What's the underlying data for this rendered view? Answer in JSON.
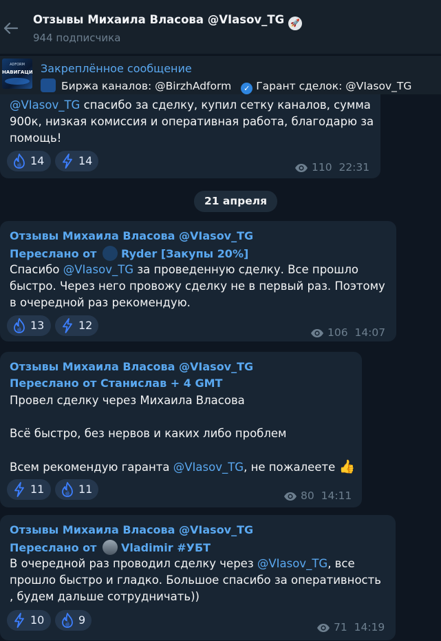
{
  "header": {
    "title": "Отзывы Михаила Власова @VIasov_TG",
    "subscribers": "944 подписчика"
  },
  "pinned": {
    "label": "Закреплённое сообщение",
    "thumb_top": "ADFORM",
    "thumb_main": "НАВИГАЦИЯ",
    "line_a": "Биржа каналов: @BirzhAdform",
    "line_b": "Гарант сделок:  @VIasov_TG"
  },
  "date_separator": "21 апреля",
  "messages": [
    {
      "text_lines": [
        "@VIasov_TG спасибо за сделку, купил сетку каналов, сумма",
        "900к, низкая комиссия и оперативная работа, благодарю за",
        "помощь!"
      ],
      "reactions": [
        {
          "icon": "flame-icon",
          "count": "14"
        },
        {
          "icon": "lightning-icon",
          "count": "14"
        }
      ],
      "views": "110",
      "time": "22:31"
    },
    {
      "author": "Отзывы Михаила Власова @VIasov_TG",
      "forwarded_prefix": "Переслано от",
      "forwarded_from": "Ryder [Закупы 20%]",
      "text_line1_a": "Спасибо ",
      "text_line1_link": "@VIasov_TG",
      "text_line1_b": " за проведенную сделку. Все прошло",
      "text_line2": "быстро. Через него провожу сделку не в первый раз. Поэтому",
      "text_line3": "в очередной раз рекомендую.",
      "reactions": [
        {
          "icon": "flame-icon",
          "count": "13"
        },
        {
          "icon": "lightning-icon",
          "count": "12"
        }
      ],
      "views": "106",
      "time": "14:07"
    },
    {
      "author": "Отзывы Михаила Власова @VIasov_TG",
      "forwarded": "Переслано от Станислав + 4 GMT",
      "text_line1": "Провел сделку через Михаила Власова",
      "text_line2": "Всё быстро, без нервов и каких либо проблем",
      "text_line3_a": "Всем рекомендую гаранта ",
      "text_line3_link": "@VIasov_TG",
      "text_line3_b": ", не пожалеете ",
      "emoji": "👍",
      "reactions": [
        {
          "icon": "lightning-icon",
          "count": "11"
        },
        {
          "icon": "flame-icon",
          "count": "11"
        }
      ],
      "views": "80",
      "time": "14:11"
    },
    {
      "author": "Отзывы Михаила Власова @VIasov_TG",
      "forwarded_prefix": "Переслано от",
      "forwarded_from": "Vladimir #УБТ",
      "text_line1_a": "В очередной раз проводил сделку через ",
      "text_line1_link": "@VIasov_TG",
      "text_line1_b": ", все",
      "text_line2": "прошло быстро и гладко. Большое спасибо за оперативность",
      "text_line3": ", будем дальше сотрудничать))",
      "reactions": [
        {
          "icon": "lightning-icon",
          "count": "10"
        },
        {
          "icon": "flame-icon",
          "count": "9"
        }
      ],
      "views": "71",
      "time": "14:19"
    }
  ],
  "colors": {
    "background": "#0e1621",
    "bubble": "#182533",
    "accent": "#5aa8f0",
    "reaction": "#25374d",
    "muted": "#6d7f8f"
  }
}
